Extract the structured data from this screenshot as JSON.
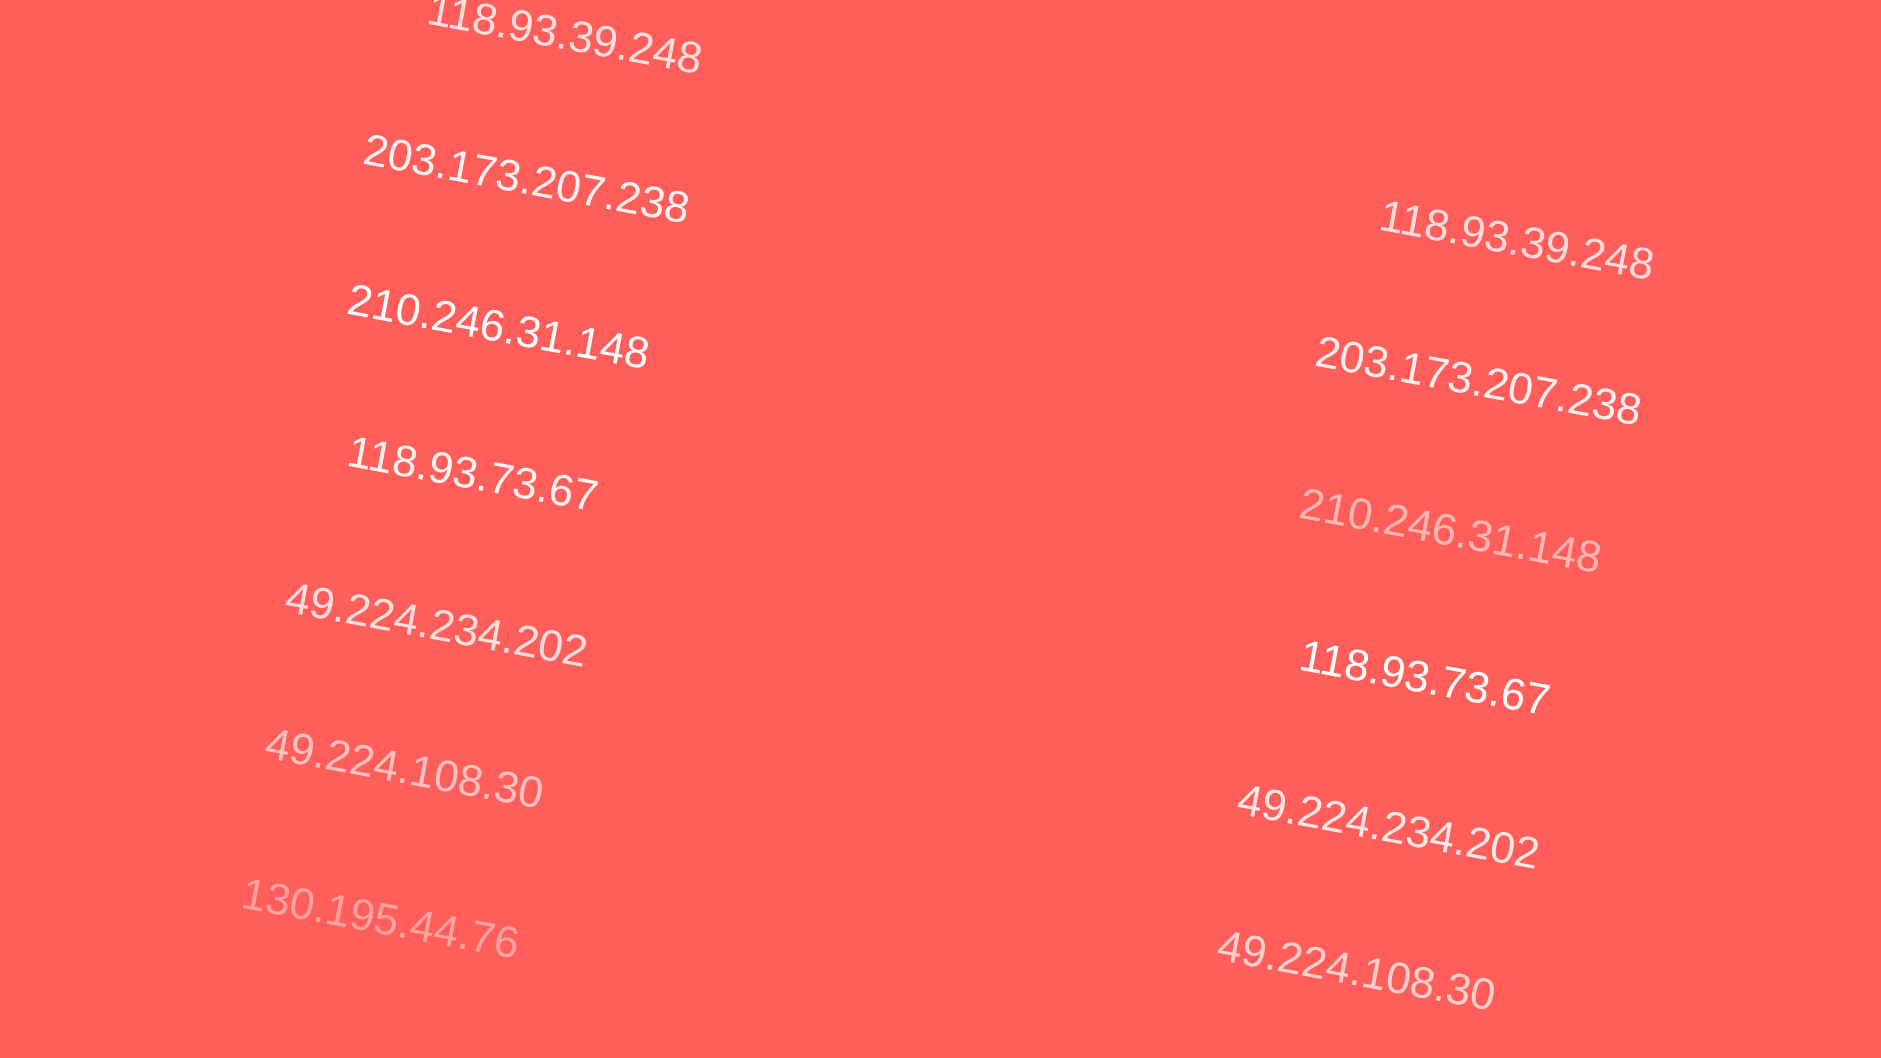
{
  "background_color": "#ff5e5b",
  "text_color": "#ffffff",
  "left_column": [
    {
      "text": "118.93.39.248",
      "opacity": 0.8
    },
    {
      "text": "203.173.207.238",
      "opacity": 0.92
    },
    {
      "text": "210.246.31.148",
      "opacity": 1.0
    },
    {
      "text": "118.93.73.67",
      "opacity": 0.92
    },
    {
      "text": "49.224.234.202",
      "opacity": 0.8
    },
    {
      "text": "49.224.108.30",
      "opacity": 0.62
    },
    {
      "text": "130.195.44.76",
      "opacity": 0.42
    }
  ],
  "right_column": [
    {
      "text": "118.93.39.248",
      "opacity": 0.78
    },
    {
      "text": "203.173.207.238",
      "opacity": 0.9
    },
    {
      "text": "210.246.31.148",
      "opacity": 0.55
    },
    {
      "text": "118.93.73.67",
      "opacity": 1.0
    },
    {
      "text": "49.224.234.202",
      "opacity": 0.85
    },
    {
      "text": "49.224.108.30",
      "opacity": 0.7
    }
  ]
}
